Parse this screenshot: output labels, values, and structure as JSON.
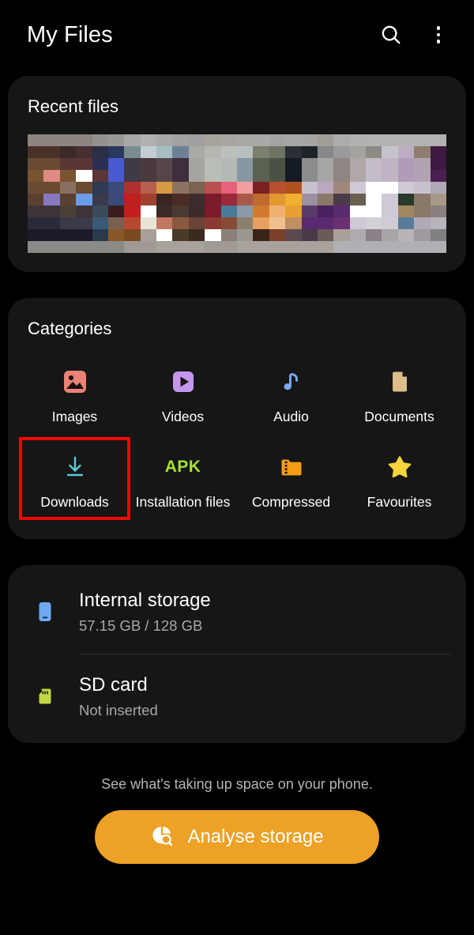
{
  "header": {
    "title": "My Files",
    "search_icon": "search-icon",
    "overflow_icon": "more-vertical-icon"
  },
  "recent": {
    "title": "Recent files",
    "thumbnail_alt": "recent-files-thumbnail-strip"
  },
  "categories": {
    "title": "Categories",
    "items": [
      {
        "label": "Images",
        "icon": "image-icon",
        "color": "#ea8375"
      },
      {
        "label": "Videos",
        "icon": "video-play-icon",
        "color": "#c696ef"
      },
      {
        "label": "Audio",
        "icon": "music-note-icon",
        "color": "#7aa9f2"
      },
      {
        "label": "Documents",
        "icon": "document-icon",
        "color": "#ddbd8b"
      },
      {
        "label": "Downloads",
        "icon": "download-icon",
        "color": "#5ec8d8",
        "highlighted": true
      },
      {
        "label": "Installation files",
        "icon": "apk-icon",
        "color": "#a6e22e",
        "badge_text": "APK"
      },
      {
        "label": "Compressed",
        "icon": "zip-folder-icon",
        "color": "#f59c16"
      },
      {
        "label": "Favourites",
        "icon": "star-icon",
        "color": "#f7d33c"
      }
    ],
    "highlight_color": "#fb0007"
  },
  "storage": {
    "rows": [
      {
        "name": "Internal storage",
        "sub": "57.15 GB / 128 GB",
        "icon": "phone-icon",
        "color": "#71a9f0"
      },
      {
        "name": "SD card",
        "sub": "Not inserted",
        "icon": "sd-card-icon",
        "color": "#c3d647"
      }
    ]
  },
  "footer": {
    "note": "See what's taking up space on your phone.",
    "analyse_label": "Analyse storage",
    "analyse_icon": "pie-chart-search-icon",
    "analyse_color": "#eda126"
  },
  "thumbnail_pixels": [
    "#8d8580",
    "#8d8580",
    "#8d8580",
    "#8d8580",
    "#94918c",
    "#9a9894",
    "#a8a8a6",
    "#b0b1b2",
    "#a8a9ab",
    "#a2a2a2",
    "#a0a09e",
    "#a8a49c",
    "#a9a6a2",
    "#aaa8a4",
    "#a9a9a7",
    "#a3a5a5",
    "#a5a6a6",
    "#a6a5a3",
    "#a19e98",
    "#adacaa",
    "#b1b1b1",
    "#b3b3b3",
    "#b2b2b2",
    "#b4b4b4",
    "#b3b3b3",
    "#b2b2b2",
    "#4a3228",
    "#4a3228",
    "#3a2a28",
    "#452f30",
    "#2a2e46",
    "#27395c",
    "#7b8b92",
    "#c2ced1",
    "#a8bcc4",
    "#6d8196",
    "#a9aaa6",
    "#b5b6b0",
    "#bcc0bd",
    "#b9bfbd",
    "#7a7f6e",
    "#6e7364",
    "#2a2f36",
    "#1e232a",
    "#88888a",
    "#9a9a9c",
    "#a5a39e",
    "#8e8b86",
    "#c7c3cc",
    "#bbafc1",
    "#8e7d70",
    "#3d1a40",
    "#6b4a32",
    "#6b4a32",
    "#5c3636",
    "#5c3636",
    "#2b2f52",
    "#4a5ad0",
    "#3f3a44",
    "#4a3a3e",
    "#56464c",
    "#3e2e3e",
    "#a4a5a0",
    "#b9bdb8",
    "#b3b9b5",
    "#8898a2",
    "#5b6150",
    "#4b5245",
    "#141a22",
    "#8c8c8e",
    "#a6a6a4",
    "#8e8682",
    "#b0a8a8",
    "#c4bcc8",
    "#c0b4c4",
    "#b09cb8",
    "#b0a4b0",
    "#3d1a40",
    "#7a5430",
    "#e08a84",
    "#7a5430",
    "#ffffff",
    "#5c3636",
    "#4a5ad0",
    "#3f3a44",
    "#4a3a3e",
    "#56464c",
    "#3e2e3e",
    "#a4a5a0",
    "#b9bdb8",
    "#b3b9b5",
    "#8898a2",
    "#5b6150",
    "#4b5245",
    "#141a22",
    "#8c8c8e",
    "#a6a6a4",
    "#8e8682",
    "#b0a8a8",
    "#c4bcc8",
    "#c0b4c4",
    "#b09cb8",
    "#b0a4b0",
    "#4a2050",
    "#6b4a32",
    "#6b4a32",
    "#8a7060",
    "#6b4a32",
    "#2e3a52",
    "#3a4a7a",
    "#b03030",
    "#b86050",
    "#d89a40",
    "#8a7460",
    "#7a6450",
    "#b85050",
    "#e8607a",
    "#f0a0a0",
    "#7a2020",
    "#b85030",
    "#b05020",
    "#c8c2cf",
    "#b9a8c0",
    "#a08878",
    "#cfc9d6",
    "#ffffff",
    "#ffffff",
    "#cfc9d6",
    "#c8c2cf",
    "#b0a8b4",
    "#5a4030",
    "#8878c0",
    "#5a4030",
    "#6a9ce8",
    "#3a3a4a",
    "#3a4a7a",
    "#c02020",
    "#a04030",
    "#3a2424",
    "#4a2c24",
    "#3c2c2c",
    "#7a1a2a",
    "#9a2a3a",
    "#a85a4a",
    "#c06a30",
    "#e09a30",
    "#f0b030",
    "#9a90a0",
    "#8a7868",
    "#4a3a4a",
    "#6a6050",
    "#ffffff",
    "#cfc9d6",
    "#2a3a2a",
    "#8a7868",
    "#a89888",
    "#3e3438",
    "#3e3438",
    "#4a4038",
    "#3e3438",
    "#3a4a5a",
    "#3a1c1c",
    "#c02020",
    "#ffffff",
    "#3a2a28",
    "#4a3a34",
    "#3a2a28",
    "#7a1a2a",
    "#4a7a9a",
    "#8a9aa8",
    "#d07a30",
    "#f0b070",
    "#e8a030",
    "#5a3a6a",
    "#4a2060",
    "#5a2a70",
    "#ffffff",
    "#ffffff",
    "#cfc9d6",
    "#a08860",
    "#8a7868",
    "#8a8080",
    "#2a2a3a",
    "#2a2a3a",
    "#3a3a48",
    "#3a3a48",
    "#3a5a78",
    "#7a6050",
    "#b84830",
    "#e8e4d8",
    "#c07860",
    "#8a5a40",
    "#6a4238",
    "#8a3a30",
    "#8a4a38",
    "#8a8070",
    "#e8a060",
    "#f0c090",
    "#c09060",
    "#5a2a70",
    "#5a2a70",
    "#6a3070",
    "#cfc9d6",
    "#d4d0d8",
    "#d0ccd4",
    "#5a7a9a",
    "#b0aab8",
    "#b8b4bc",
    "#1a1a28",
    "#1a1a28",
    "#1a1a28",
    "#1a1a28",
    "#2a3a4a",
    "#8a5828",
    "#7a4a20",
    "#a8a098",
    "#ffffff",
    "#4a3a28",
    "#3a2a20",
    "#ffffff",
    "#8a8078",
    "#9a9890",
    "#3a2418",
    "#7a4028",
    "#5a4a50",
    "#4a3a48",
    "#6a5a58",
    "#a8a098",
    "#b0aab0",
    "#8a8088",
    "#a8a4a8",
    "#b8b4b8",
    "#a09aa0",
    "#808080",
    "#8a8a86",
    "#8a8a86",
    "#8a8a86",
    "#8a8a86",
    "#8a8a86",
    "#8a8a86",
    "#a09a96",
    "#a09a96",
    "#a8a29c",
    "#a8a29c",
    "#a8a29c",
    "#a09a96",
    "#a09a96",
    "#a8a29c",
    "#a8a29c",
    "#a8a29c",
    "#a8a29c",
    "#a8a29c",
    "#a8a29c",
    "#b0b0b4",
    "#b0b0b4",
    "#b0b0b4",
    "#b0b0b4",
    "#b0b0b4",
    "#b0b0b4",
    "#b0b0b4"
  ]
}
